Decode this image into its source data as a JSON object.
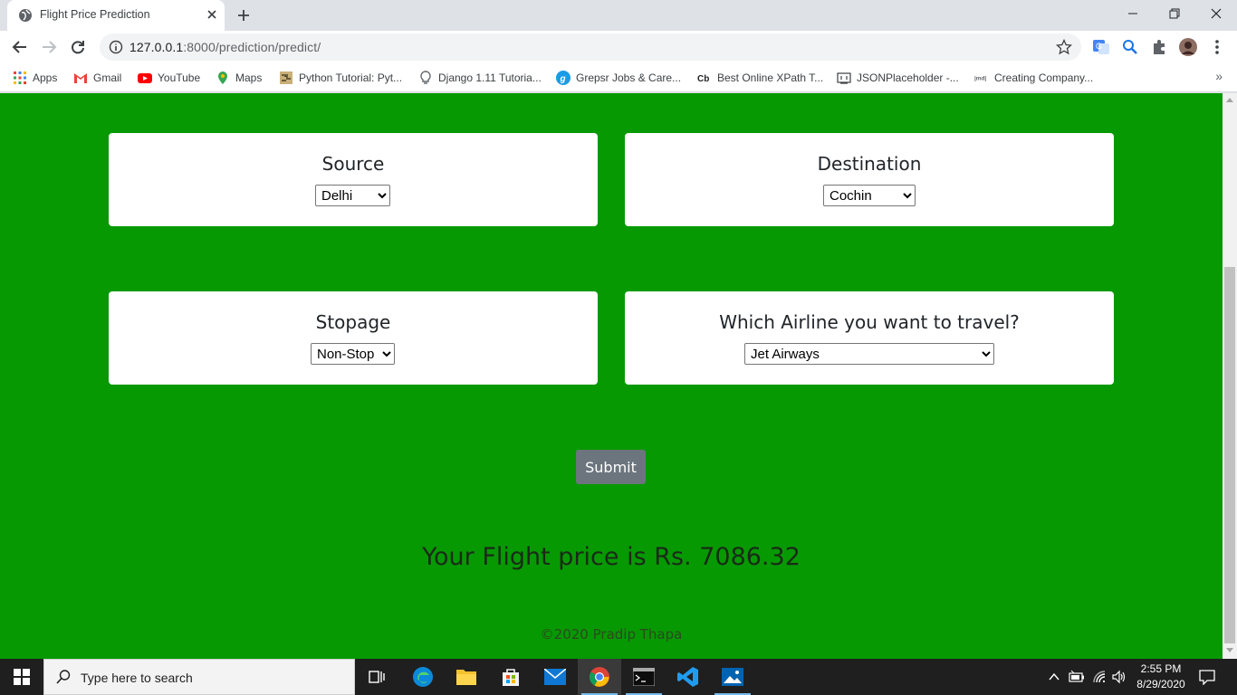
{
  "browser": {
    "tab_title": "Flight Price Prediction",
    "url_host": "127.0.0.1",
    "url_path": ":8000/prediction/predict/"
  },
  "bookmarks": [
    {
      "label": "Apps",
      "icon": "apps-grid-icon"
    },
    {
      "label": "Gmail",
      "icon": "gmail-icon"
    },
    {
      "label": "YouTube",
      "icon": "youtube-icon"
    },
    {
      "label": "Maps",
      "icon": "maps-icon"
    },
    {
      "label": "Python Tutorial: Pyt...",
      "icon": "python-icon"
    },
    {
      "label": "Django 1.11 Tutoria...",
      "icon": "lightbulb-icon"
    },
    {
      "label": "Grepsr Jobs & Care...",
      "icon": "grepsr-icon"
    },
    {
      "label": "Best Online XPath T...",
      "icon": "cb-icon"
    },
    {
      "label": "JSONPlaceholder -...",
      "icon": "json-icon"
    },
    {
      "label": "Creating Company...",
      "icon": "md-icon"
    }
  ],
  "page": {
    "source": {
      "label": "Source",
      "selected": "Delhi"
    },
    "destination": {
      "label": "Destination",
      "selected": "Cochin"
    },
    "stopage": {
      "label": "Stopage",
      "selected": "Non-Stop"
    },
    "airline": {
      "label": "Which Airline you want to travel?",
      "selected": "Jet Airways"
    },
    "submit_label": "Submit",
    "result_text": "Your Flight price is Rs. 7086.32",
    "footer_text": "©2020 Pradip Thapa"
  },
  "taskbar": {
    "search_placeholder": "Type here to search",
    "time": "2:55 PM",
    "date": "8/29/2020"
  },
  "colors": {
    "page_background": "#079902",
    "submit_button": "#6c757d"
  }
}
